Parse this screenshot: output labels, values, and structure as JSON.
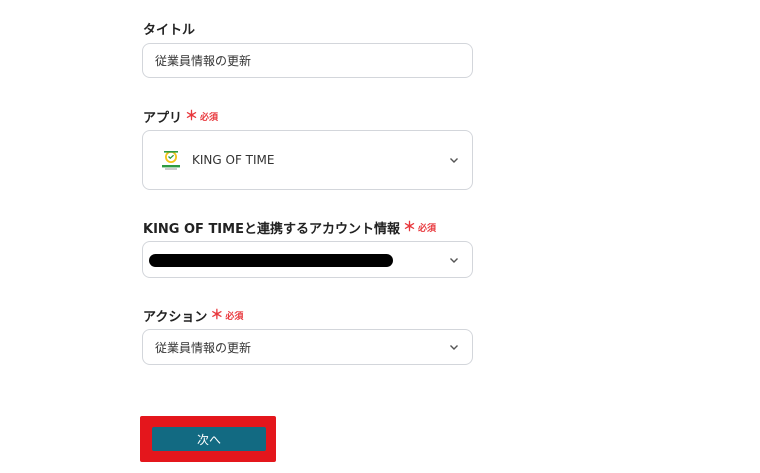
{
  "form": {
    "title": {
      "label": "タイトル",
      "value": "従業員情報の更新"
    },
    "app": {
      "label": "アプリ",
      "required_mark": "＊",
      "required_text": "必須",
      "value": "KING OF TIME",
      "icon": "king-of-time-logo"
    },
    "account": {
      "label": "KING OF TIMEと連携するアカウント情報",
      "required_mark": "＊",
      "required_text": "必須"
    },
    "action": {
      "label": "アクション",
      "required_mark": "＊",
      "required_text": "必須",
      "value": "従業員情報の更新"
    }
  },
  "next_button": {
    "label": "次へ"
  },
  "colors": {
    "required": "#e8383d",
    "button": "#126a82",
    "highlight": "#e4161c"
  }
}
